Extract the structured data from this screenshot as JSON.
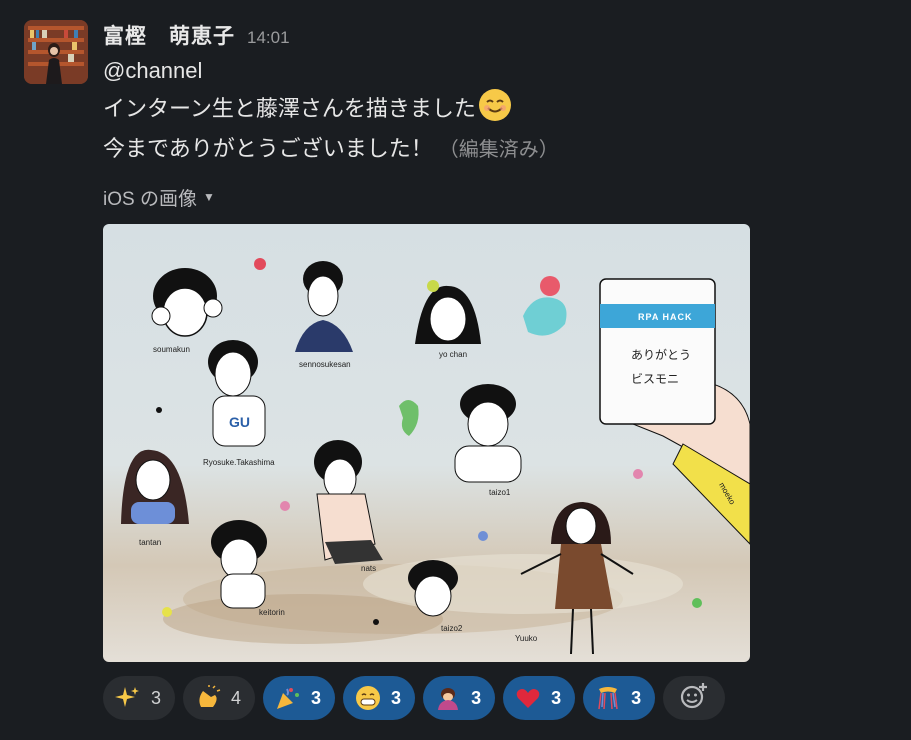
{
  "message": {
    "author": "富樫　萌恵子",
    "time": "14:01",
    "mention": "@channel",
    "line1": "インターン生と藤澤さんを描きました",
    "line2": "今までありがとうございました！",
    "edited": "（編集済み）"
  },
  "attachment": {
    "label": "iOS の画像",
    "card": {
      "brand": "RPA HACK",
      "line1": "ありがとう",
      "line2": "ビスモニ"
    },
    "sleeve_text": "moeko",
    "shirt_text": "GU",
    "characters": [
      "soumakun",
      "sennosukesan",
      "yo chan",
      "Ryosuke.Takashima",
      "taizo1",
      "tantan",
      "nats",
      "keitorin",
      "taizo2",
      "Yuuko"
    ]
  },
  "reactions": [
    {
      "icon": "sparkles-icon",
      "count": "3",
      "mine": false
    },
    {
      "icon": "clap-icon",
      "count": "4",
      "mine": false
    },
    {
      "icon": "party-popper-icon",
      "count": "3",
      "mine": true
    },
    {
      "icon": "grin-icon",
      "count": "3",
      "mine": true
    },
    {
      "icon": "bowing-person-icon",
      "count": "3",
      "mine": true
    },
    {
      "icon": "heart-icon",
      "count": "3",
      "mine": true
    },
    {
      "icon": "confetti-ball-icon",
      "count": "3",
      "mine": true
    }
  ],
  "colors": {
    "background": "#1a1d21",
    "reaction_mine": "#1d5a95",
    "reaction_default": "#2a2d31"
  }
}
